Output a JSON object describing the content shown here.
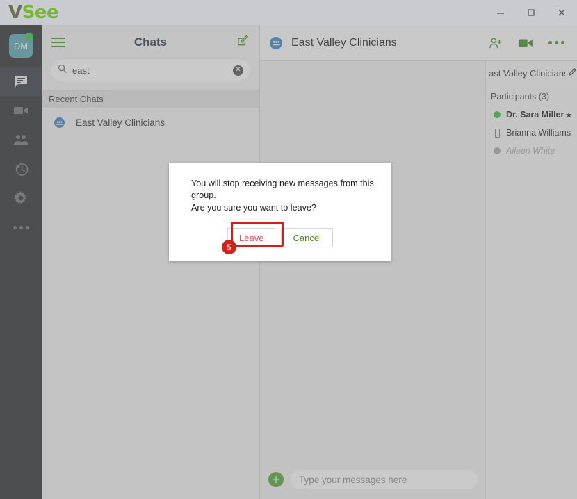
{
  "titlebar": {
    "logo_v": "V",
    "logo_see": "See",
    "minimize_label": "minimize-icon",
    "maximize_label": "maximize-icon",
    "close_label": "close-icon"
  },
  "rail": {
    "avatar_initials": "DM",
    "items": [
      {
        "icon": "chat-icon",
        "active": true
      },
      {
        "icon": "video-camera-icon",
        "active": false
      },
      {
        "icon": "contacts-icon",
        "active": false
      },
      {
        "icon": "waiting-room-icon",
        "active": false
      },
      {
        "icon": "settings-gear-icon",
        "active": false
      },
      {
        "icon": "more-options-icon",
        "active": false
      }
    ]
  },
  "chat_list": {
    "menu_icon": "hamburger-menu-icon",
    "title": "Chats",
    "compose_icon": "compose-new-chat-icon",
    "search": {
      "icon": "search-icon",
      "value": "east",
      "clear_icon": "✕"
    },
    "section_header": "Recent Chats",
    "rows": [
      {
        "name": "East Valley Clinicians",
        "icon": "group-chat-icon"
      }
    ]
  },
  "conversation": {
    "group_icon": "group-chat-icon",
    "title": "East Valley Clinicians",
    "actions": [
      {
        "name": "add-participant-icon"
      },
      {
        "name": "start-video-call-icon"
      },
      {
        "name": "more-options-icon"
      }
    ],
    "composer": {
      "attach_label": "+",
      "placeholder": "Type your messages here"
    }
  },
  "participants_panel": {
    "group_name_clipped": "ast Valley Clinicians",
    "edit_icon": "edit-pencil-icon",
    "count_label": "Participants (3)",
    "members": [
      {
        "name": "Dr. Sara Miller",
        "status": "online",
        "owner": true,
        "star": "★"
      },
      {
        "name": "Brianna Williams",
        "status": "mobile",
        "owner": false,
        "star": ""
      },
      {
        "name": "Aileen White",
        "status": "offline",
        "owner": false,
        "star": ""
      }
    ]
  },
  "dialog": {
    "line1": "You will stop receiving new messages from this group.",
    "line2": "Are you sure you want to leave?",
    "leave_label": "Leave",
    "cancel_label": "Cancel"
  },
  "annotation": {
    "step_number": "5"
  },
  "colors": {
    "brand_green": "#76b82a",
    "accent_green": "#4a8c2c",
    "group_blue": "#3b82c4",
    "online_green": "#2fbf3f",
    "danger_red": "#d9534f",
    "annotation_red": "#d61f19",
    "rail_dark": "#262a2e"
  }
}
